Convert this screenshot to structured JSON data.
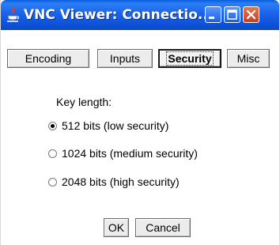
{
  "window": {
    "title": "VNC Viewer: Connectio...",
    "icon": "java-icon",
    "title_bar_color": "#0a5fe0"
  },
  "tabs": [
    {
      "label": "Encoding",
      "selected": false
    },
    {
      "label": "Inputs",
      "selected": false
    },
    {
      "label": "Security",
      "selected": true
    },
    {
      "label": "Misc",
      "selected": false
    }
  ],
  "security": {
    "key_length_label": "Key length:",
    "options": [
      {
        "label": "512 bits (low security)",
        "checked": true
      },
      {
        "label": "1024 bits (medium security)",
        "checked": false
      },
      {
        "label": "2048 bits (high security)",
        "checked": false
      }
    ]
  },
  "buttons": {
    "ok": "OK",
    "cancel": "Cancel"
  }
}
